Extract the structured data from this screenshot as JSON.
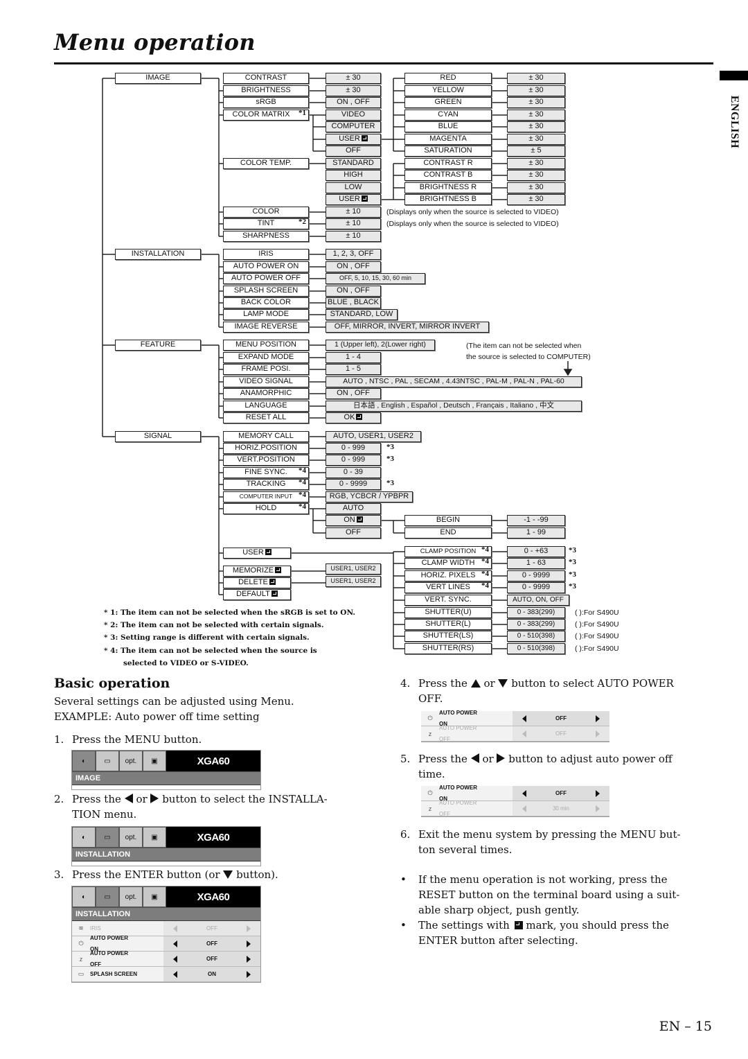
{
  "page": {
    "title": "Menu operation",
    "language_tab": "ENGLISH",
    "page_number": "EN – 15"
  },
  "tree": {
    "image": {
      "label": "IMAGE",
      "items": [
        {
          "label": "CONTRAST",
          "value": "± 30"
        },
        {
          "label": "BRIGHTNESS",
          "value": "± 30"
        },
        {
          "label": "sRGB",
          "value": "ON , OFF"
        },
        {
          "label": "COLOR MATRIX",
          "star": "*1",
          "options": [
            "VIDEO",
            "COMPUTER",
            "USER",
            "OFF"
          ]
        },
        {
          "label": "COLOR TEMP.",
          "options": [
            "STANDARD",
            "HIGH",
            "LOW",
            "USER"
          ]
        },
        {
          "label": "COLOR",
          "value": "± 10",
          "note": "(Displays only when the source is selected to VIDEO)"
        },
        {
          "label": "TINT",
          "star": "*2",
          "value": "± 10",
          "note": "(Displays only when the source is selected to VIDEO)"
        },
        {
          "label": "SHARPNESS",
          "value": "± 10"
        }
      ],
      "color_matrix_user": [
        {
          "label": "RED",
          "value": "± 30"
        },
        {
          "label": "YELLOW",
          "value": "± 30"
        },
        {
          "label": "GREEN",
          "value": "± 30"
        },
        {
          "label": "CYAN",
          "value": "± 30"
        },
        {
          "label": "BLUE",
          "value": "± 30"
        },
        {
          "label": "MAGENTA",
          "value": "± 30"
        },
        {
          "label": "SATURATION",
          "value": "± 5"
        }
      ],
      "color_temp_user": [
        {
          "label": "CONTRAST R",
          "value": "± 30"
        },
        {
          "label": "CONTRAST B",
          "value": "± 30"
        },
        {
          "label": "BRIGHTNESS R",
          "value": "± 30"
        },
        {
          "label": "BRIGHTNESS B",
          "value": "± 30"
        }
      ]
    },
    "installation": {
      "label": "INSTALLATION",
      "items": [
        {
          "label": "IRIS",
          "value": "1, 2, 3, OFF"
        },
        {
          "label": "AUTO POWER ON",
          "value": "ON , OFF"
        },
        {
          "label": "AUTO POWER OFF",
          "value": "OFF, 5, 10, 15, 30, 60 min"
        },
        {
          "label": "SPLASH SCREEN",
          "value": "ON , OFF"
        },
        {
          "label": "BACK COLOR",
          "value": "BLUE , BLACK"
        },
        {
          "label": "LAMP MODE",
          "value": "STANDARD, LOW"
        },
        {
          "label": "IMAGE REVERSE",
          "value": "OFF, MIRROR, INVERT, MIRROR INVERT"
        }
      ]
    },
    "feature": {
      "label": "FEATURE",
      "note": "(The item can not be selected when the source is selected to COMPUTER)",
      "note_line1": "(The item can not be selected when",
      "note_line2": "the source is selected to COMPUTER)",
      "items": [
        {
          "label": "MENU POSITION",
          "value": "1 (Upper left), 2(Lower right)"
        },
        {
          "label": "EXPAND MODE",
          "value": "1 - 4"
        },
        {
          "label": "FRAME POSI.",
          "value": "1 - 5"
        },
        {
          "label": "VIDEO SIGNAL",
          "value": "AUTO , NTSC , PAL , SECAM , 4.43NTSC , PAL-M , PAL-N , PAL-60"
        },
        {
          "label": "ANAMORPHIC",
          "value": "ON , OFF"
        },
        {
          "label": "LANGUAGE",
          "value": "日本語 , English , Español , Deutsch , Français , Italiano , 中文"
        },
        {
          "label": "RESET ALL",
          "value": "OK"
        }
      ]
    },
    "signal": {
      "label": "SIGNAL",
      "items": [
        {
          "label": "MEMORY CALL",
          "value": "AUTO, USER1, USER2"
        },
        {
          "label": "HORIZ.POSITION",
          "value": "0 - 999",
          "mark": "*3"
        },
        {
          "label": "VERT.POSITION",
          "value": "0 - 999",
          "mark": "*3"
        },
        {
          "label": "FINE SYNC.",
          "star": "*4",
          "value": "0 - 39"
        },
        {
          "label": "TRACKING",
          "star": "*4",
          "value": "0 - 9999",
          "mark": "*3"
        },
        {
          "label": "COMPUTER INPUT",
          "star": "*4",
          "value": "RGB, YCBCR / YPBPR"
        },
        {
          "label": "HOLD",
          "star": "*4",
          "options": [
            "AUTO",
            "ON",
            "OFF"
          ]
        },
        {
          "label": "USER"
        },
        {
          "label": "MEMORIZE",
          "value": "USER1, USER2"
        },
        {
          "label": "DELETE",
          "value": "USER1, USER2"
        },
        {
          "label": "DEFAULT"
        }
      ],
      "hold_on": [
        {
          "label": "BEGIN",
          "value": "-1 - -99"
        },
        {
          "label": "END",
          "value": "1 - 99"
        }
      ],
      "user_items": [
        {
          "label": "CLAMP POSITION",
          "star": "*4",
          "value": "0 - +63",
          "mark": "*3"
        },
        {
          "label": "CLAMP WIDTH",
          "star": "*4",
          "value": "1 - 63",
          "mark": "*3"
        },
        {
          "label": "HORIZ. PIXELS",
          "star": "*4",
          "value": "0 - 9999",
          "mark": "*3"
        },
        {
          "label": "VERT LINES",
          "star": "*4",
          "value": "0 - 9999",
          "mark": "*3"
        },
        {
          "label": "VERT. SYNC.",
          "value": "AUTO, ON, OFF"
        },
        {
          "label": "SHUTTER(U)",
          "value": "0 - 383(299)",
          "note": "( ):For S490U"
        },
        {
          "label": "SHUTTER(L)",
          "value": "0 - 383(299)",
          "note": "( ):For S490U"
        },
        {
          "label": "SHUTTER(LS)",
          "value": "0 - 510(398)",
          "note": "( ):For S490U"
        },
        {
          "label": "SHUTTER(RS)",
          "value": "0 - 510(398)",
          "note": "( ):For S490U"
        }
      ]
    }
  },
  "footnotes": [
    "* 1: The item can not be selected when the sRGB is set to ON.",
    "* 2: The item can not be selected with certain signals.",
    "* 3: Setting range is different with certain signals.",
    "* 4: The item can not be selected when the source is",
    "selected to VIDEO or S-VIDEO."
  ],
  "basic": {
    "heading": "Basic operation",
    "intro1": "Several settings can be adjusted using Menu.",
    "intro2": "EXAMPLE: Auto power off time setting",
    "steps": [
      {
        "n": "1.",
        "text": "Press the MENU button."
      },
      {
        "n": "2.",
        "pre": "Press the",
        "mid": "or",
        "post": "button to select the INSTALLA-",
        "line2": "TION menu."
      },
      {
        "n": "3.",
        "pre": "Press the ENTER button (or",
        "post": "button)."
      },
      {
        "n": "4.",
        "pre": "Press the",
        "mid": "or",
        "post": "button to select AUTO POWER",
        "line2": "OFF."
      },
      {
        "n": "5.",
        "pre": "Press the",
        "mid": "or",
        "post": "button to adjust auto power off",
        "line2": "time."
      },
      {
        "n": "6.",
        "text": "Exit the menu system by pressing the MENU but-",
        "line2": "ton several times."
      }
    ],
    "bullets": [
      {
        "l1": "If the menu operation is not working, press the",
        "l2": "RESET button on the terminal board using a suit-",
        "l3": "able sharp object, push gently."
      },
      {
        "pre": "The settings with",
        "post": "mark, you should press the",
        "l2": "ENTER button after selecting."
      }
    ]
  },
  "osd": {
    "model": "XGA60",
    "opt_label": "opt.",
    "menu1_category": "IMAGE",
    "menu2_category": "INSTALLATION",
    "menu3_category": "INSTALLATION",
    "menu3_rows": [
      {
        "l1": "IRIS",
        "l2": "",
        "value": "OFF",
        "dim": true
      },
      {
        "l1": "AUTO POWER",
        "l2": "ON",
        "value": "OFF",
        "dim": false
      },
      {
        "l1": "AUTO POWER",
        "l2": "OFF",
        "value": "OFF",
        "dim": false
      },
      {
        "l1": "SPLASH SCREEN",
        "l2": "",
        "value": "ON",
        "dim": false
      }
    ],
    "step4_rows": [
      {
        "l1": "AUTO POWER",
        "l2": "ON",
        "value": "OFF",
        "dim": false
      },
      {
        "l1": "AUTO POWER",
        "l2": "OFF",
        "value": "OFF",
        "dim": true
      }
    ],
    "step5_rows": [
      {
        "l1": "AUTO POWER",
        "l2": "ON",
        "value": "OFF",
        "dim": false
      },
      {
        "l1": "AUTO POWER",
        "l2": "OFF",
        "value": "30 min",
        "dim": true
      }
    ]
  }
}
